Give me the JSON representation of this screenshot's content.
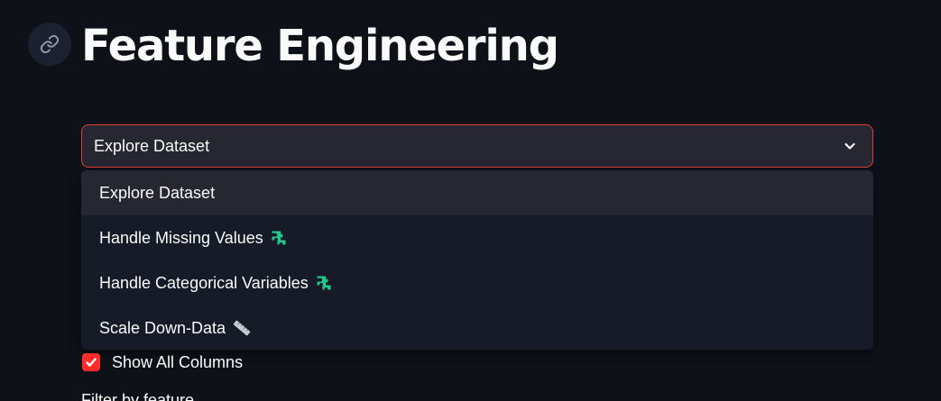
{
  "header": {
    "title": "Feature Engineering",
    "anchor_icon": "link-icon"
  },
  "select": {
    "current_value": "Explore Dataset",
    "border_color": "#e03c3c",
    "options": [
      {
        "label": "Explore Dataset",
        "icon": null
      },
      {
        "label": "Handle Missing Values",
        "icon": "puzzle-piece-icon",
        "icon_color": "#21c98a"
      },
      {
        "label": "Handle Categorical Variables",
        "icon": "puzzle-piece-icon",
        "icon_color": "#21c98a"
      },
      {
        "label": "Scale Down-Data",
        "icon": "ruler-icon"
      }
    ]
  },
  "checkbox": {
    "label": "Show All Columns",
    "checked": true,
    "color": "#ff2b2b"
  },
  "partial_text": "Filter by feature"
}
